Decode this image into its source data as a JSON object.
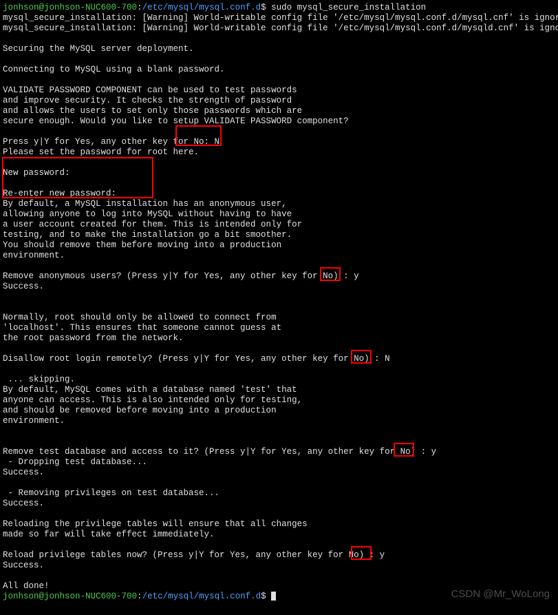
{
  "prompt1": {
    "user": "jonhson@jonhson-NUC600-700",
    "colon": ":",
    "path": "/etc/mysql/mysql.conf.d",
    "sym": "$",
    "cmd": " sudo mysql_secure_installation"
  },
  "lines": {
    "l02": "mysql_secure_installation: [Warning] World-writable config file '/etc/mysql/mysql.conf.d/mysql.cnf' is ignored.",
    "l03": "mysql_secure_installation: [Warning] World-writable config file '/etc/mysql/mysql.conf.d/mysqld.cnf' is ignored.",
    "l04": "",
    "l05": "Securing the MySQL server deployment.",
    "l06": "",
    "l07": "Connecting to MySQL using a blank password.",
    "l08": "",
    "l09": "VALIDATE PASSWORD COMPONENT can be used to test passwords",
    "l10": "and improve security. It checks the strength of password",
    "l11": "and allows the users to set only those passwords which are",
    "l12": "secure enough. Would you like to setup VALIDATE PASSWORD component?",
    "l13": "",
    "l14": "Press y|Y for Yes, any other key for No: N",
    "l15": "Please set the password for root here.",
    "l16": "",
    "l17": "New password:",
    "l18": "",
    "l19": "Re-enter new password:",
    "l20": "By default, a MySQL installation has an anonymous user,",
    "l21": "allowing anyone to log into MySQL without having to have",
    "l22": "a user account created for them. This is intended only for",
    "l23": "testing, and to make the installation go a bit smoother.",
    "l24": "You should remove them before moving into a production",
    "l25": "environment.",
    "l26": "",
    "l27": "Remove anonymous users? (Press y|Y for Yes, any other key for No) : y",
    "l28": "Success.",
    "l29": "",
    "l30": "",
    "l31": "Normally, root should only be allowed to connect from",
    "l32": "'localhost'. This ensures that someone cannot guess at",
    "l33": "the root password from the network.",
    "l34": "",
    "l35": "Disallow root login remotely? (Press y|Y for Yes, any other key for No) : N",
    "l36": "",
    "l37": " ... skipping.",
    "l38": "By default, MySQL comes with a database named 'test' that",
    "l39": "anyone can access. This is also intended only for testing,",
    "l40": "and should be removed before moving into a production",
    "l41": "environment.",
    "l42": "",
    "l43": "",
    "l44": "Remove test database and access to it? (Press y|Y for Yes, any other key for No) : y",
    "l45": " - Dropping test database...",
    "l46": "Success.",
    "l47": "",
    "l48": " - Removing privileges on test database...",
    "l49": "Success.",
    "l50": "",
    "l51": "Reloading the privilege tables will ensure that all changes",
    "l52": "made so far will take effect immediately.",
    "l53": "",
    "l54": "Reload privilege tables now? (Press y|Y for Yes, any other key for No) : y",
    "l55": "Success.",
    "l56": "",
    "l57": "All done!"
  },
  "prompt2": {
    "user": "jonhson@jonhson-NUC600-700",
    "colon": ":",
    "path": "/etc/mysql/mysql.conf.d",
    "sym": "$",
    "cmd": " "
  },
  "highlights": {
    "h1_desc": "around 'No: N' input",
    "h2_desc": "around New/Re-enter password block",
    "h3_desc": "around ': y' anonymous users",
    "h4_desc": "around ': N' root remote",
    "h5_desc": "around ': y' remove test db",
    "h6_desc": "around ': y' reload privileges"
  },
  "watermark": "CSDN @Mr_WoLong"
}
